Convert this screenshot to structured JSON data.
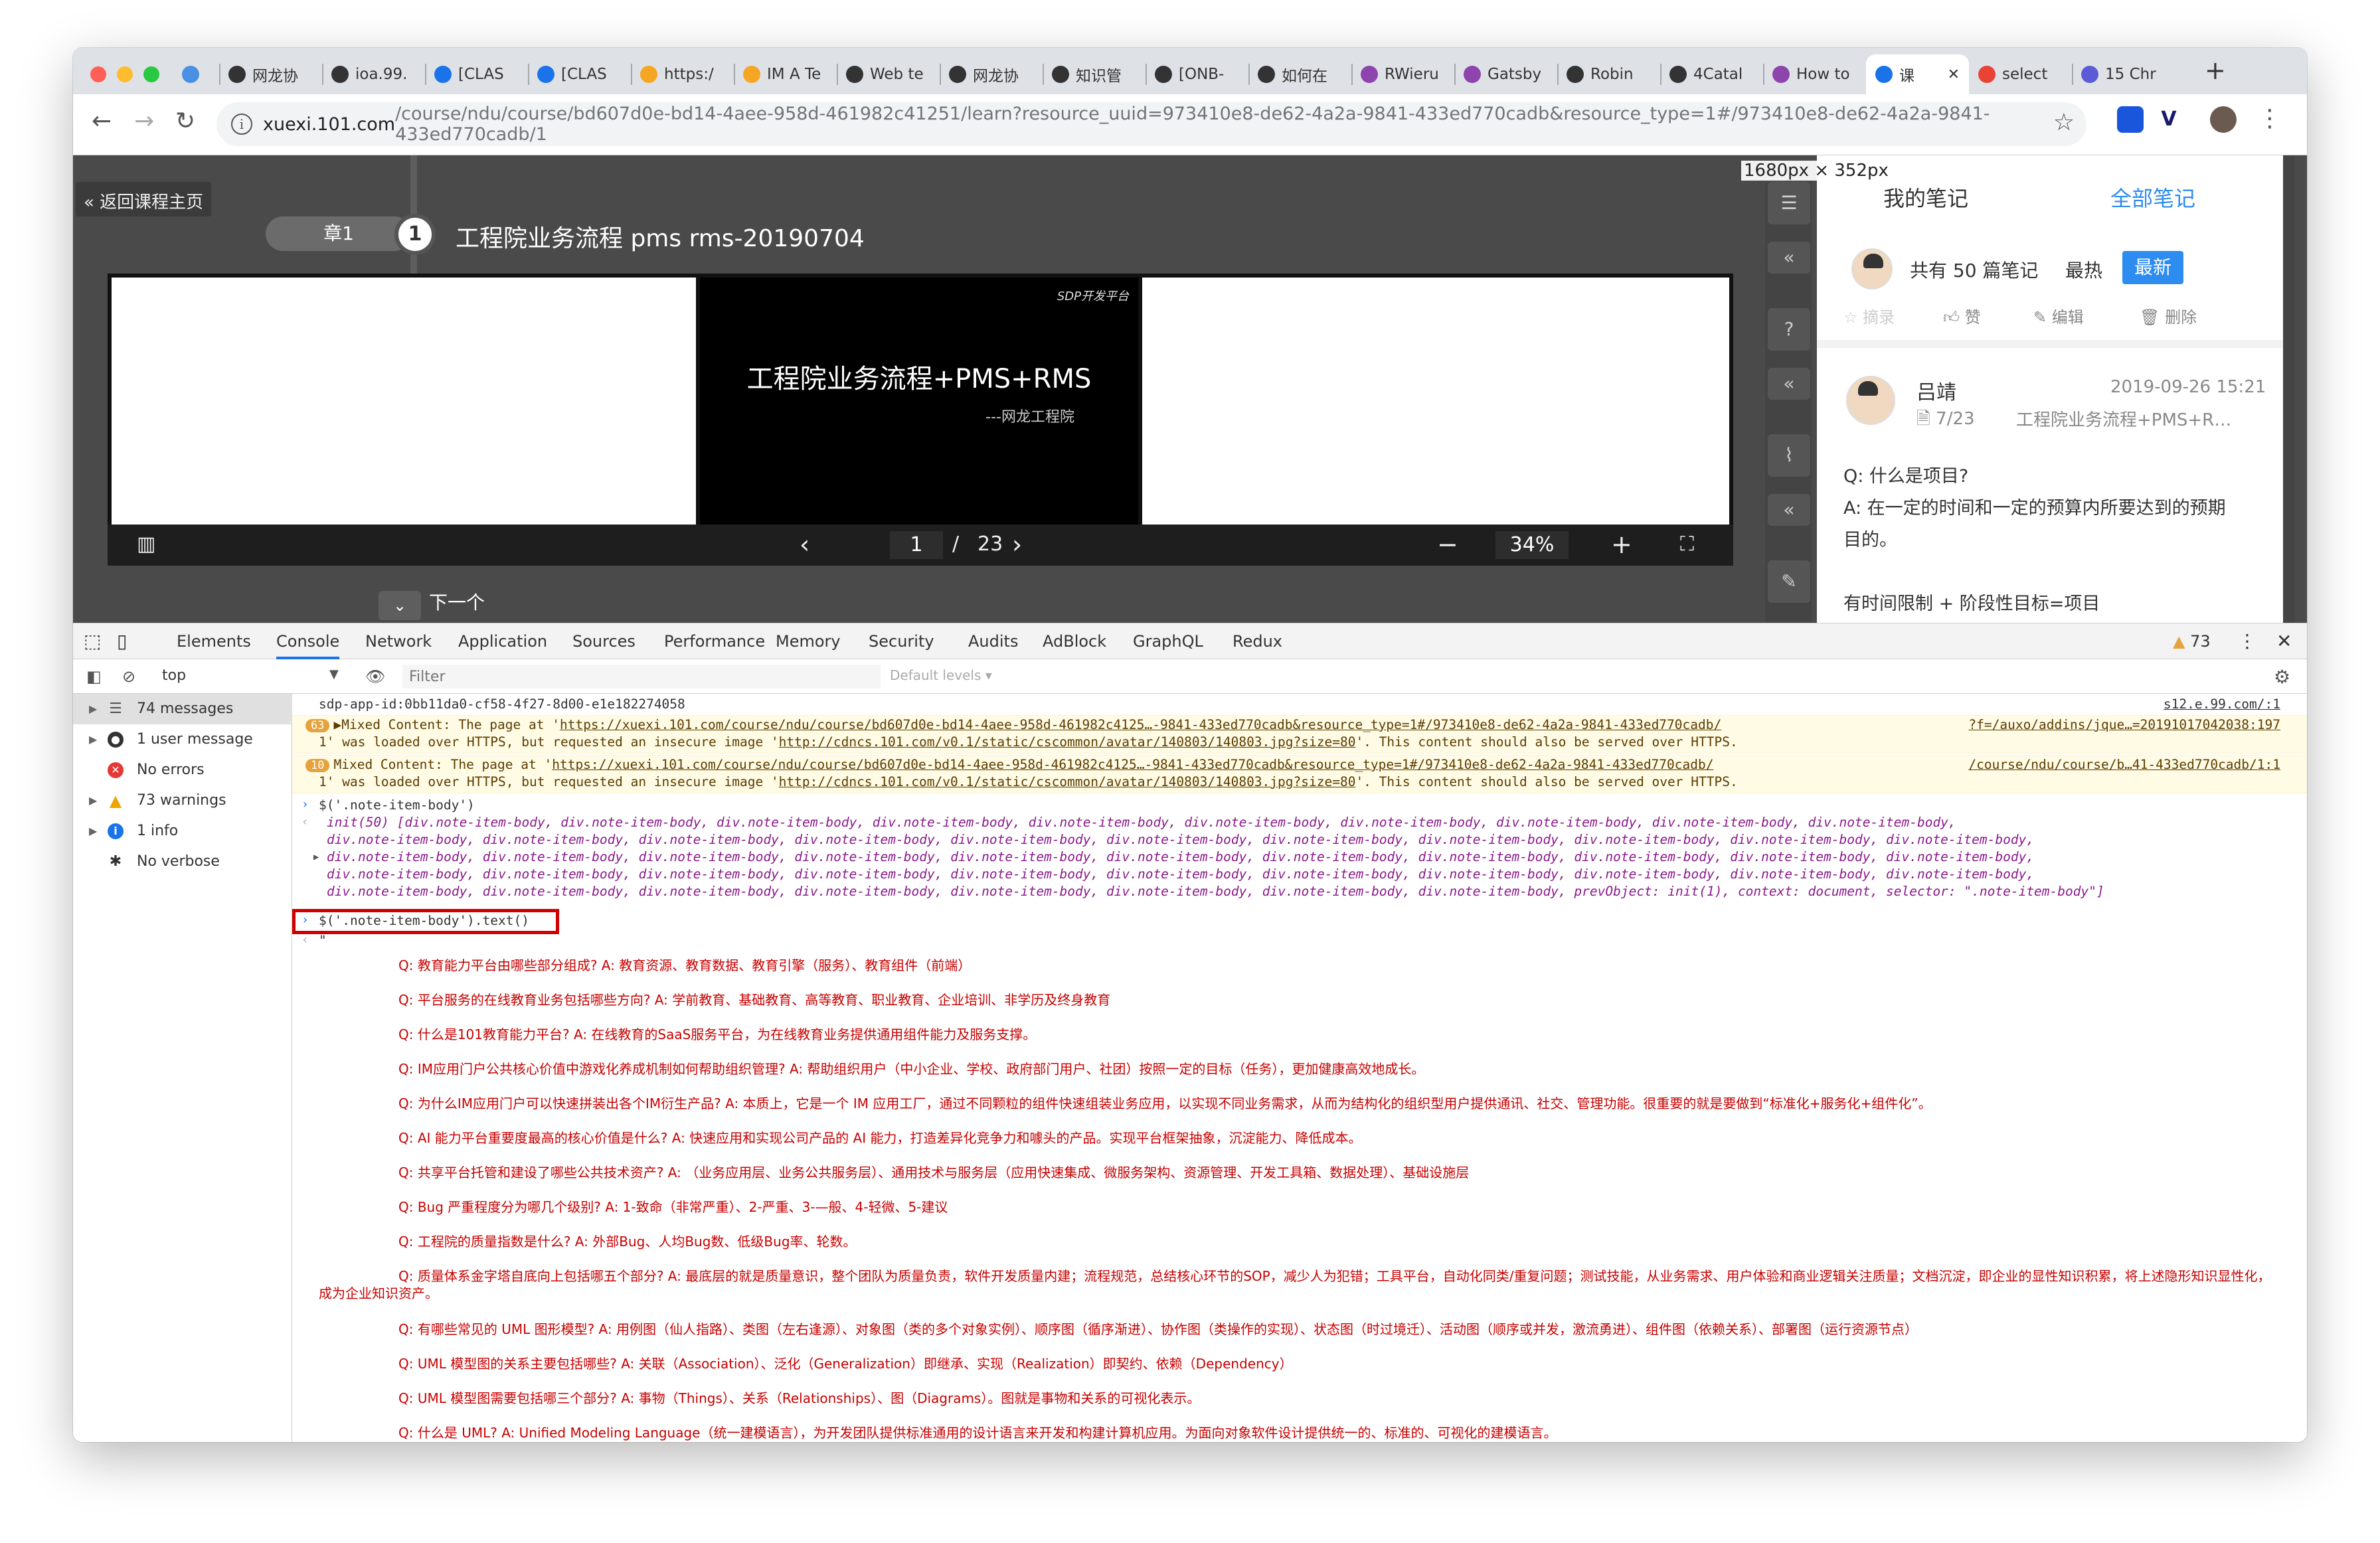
{
  "browser": {
    "tabs": [
      {
        "label": "",
        "favicon_color": "#4a90e2"
      },
      {
        "label": "网龙协",
        "favicon_color": "#333333"
      },
      {
        "label": "ioa.99.",
        "favicon_color": "#333333"
      },
      {
        "label": "[CLAS",
        "favicon_color": "#1a73e8"
      },
      {
        "label": "[CLAS",
        "favicon_color": "#1a73e8"
      },
      {
        "label": "https:/",
        "favicon_color": "#f5a623"
      },
      {
        "label": "IM A Te",
        "favicon_color": "#f5a623"
      },
      {
        "label": "Web te",
        "favicon_color": "#333333"
      },
      {
        "label": "网龙协",
        "favicon_color": "#333333"
      },
      {
        "label": "知识管",
        "favicon_color": "#333333"
      },
      {
        "label": "[ONB-",
        "favicon_color": "#333333"
      },
      {
        "label": "如何在",
        "favicon_color": "#333333"
      },
      {
        "label": "RWieru",
        "favicon_color": "#8e44ad"
      },
      {
        "label": "Gatsby",
        "favicon_color": "#8e44ad"
      },
      {
        "label": "Robin",
        "favicon_color": "#333333"
      },
      {
        "label": "4Catal",
        "favicon_color": "#333333"
      },
      {
        "label": "How to",
        "favicon_color": "#8e44ad"
      },
      {
        "label": "课",
        "favicon_color": "#1a73e8",
        "active": true
      },
      {
        "label": "select",
        "favicon_color": "#ea4335"
      },
      {
        "label": "15 Chr",
        "favicon_color": "#5b5bd6"
      }
    ],
    "new_tab": "+",
    "url_host": "xuexi.101.com",
    "url_path": "/course/ndu/course/bd607d0e-bd14-4aee-958d-461982c41251/learn?resource_uuid=973410e8-de62-4a2a-9841-433ed770cadb&resource_type=1#/973410e8-de62-4a2a-9841-433ed770cadb/1",
    "colors": {
      "tabbar": "#dee1e6",
      "red": "#ff5f57",
      "yellow": "#febc2e",
      "green": "#28c840"
    }
  },
  "course": {
    "back_label": "« 返回课程主页",
    "chapter_label": "章1",
    "chapter_num": "1",
    "lesson_title": "工程院业务流程 pms rms-20190704",
    "slide_logo": "SDP开发平台",
    "slide_title": "工程院业务流程+PMS+RMS",
    "slide_subtitle": "---网龙工程院",
    "page_current": "1",
    "page_sep": "/",
    "page_total": "23",
    "zoom": "34%",
    "next_label": "下一个",
    "dimension_badge": "1680px × 352px"
  },
  "notes": {
    "tab_mine": "我的笔记",
    "tab_all": "全部笔记",
    "count_label": "共有 50 篇笔记",
    "sort_hot": "最热",
    "sort_new": "最新",
    "act_excerpt": "摘录",
    "act_like": "赞",
    "act_edit": "编辑",
    "act_delete": "删除",
    "author": "吕靖",
    "date": "2019-09-26 15:21",
    "page_ref": "7/23",
    "source": "工程院业务流程+PMS+R…",
    "body": [
      "Q: 什么是项目?",
      "A: 在一定的时间和一定的预算内所要达到的预期",
      "目的。",
      "",
      "有时间限制 + 阶段性目标=项目"
    ]
  },
  "devtools": {
    "tabs": [
      "Elements",
      "Console",
      "Network",
      "Application",
      "Sources",
      "Performance",
      "Memory",
      "Security",
      "Audits",
      "AdBlock",
      "GraphQL",
      "Redux"
    ],
    "warn_count": "73",
    "context": "top",
    "filter_placeholder": "Filter",
    "levels": "Default levels ▾",
    "sidebar": [
      {
        "label": "74 messages",
        "icon": "list-icon"
      },
      {
        "label": "1 user message",
        "icon": "user-icon"
      },
      {
        "label": "No errors",
        "icon": "error-icon"
      },
      {
        "label": "73 warnings",
        "icon": "warning-icon"
      },
      {
        "label": "1 info",
        "icon": "info-icon"
      },
      {
        "label": "No verbose",
        "icon": "bug-icon"
      }
    ],
    "console": {
      "line1": "sdp-app-id:0bb11da0-cf58-4f27-8d00-e1e182274058",
      "line1_src": "s12.e.99.com/:1",
      "warn1_count": "63",
      "warn1_a": "Mixed Content: The page at '",
      "warn1_url": "https://xuexi.101.com/course/ndu/course/bd607d0e-bd14-4aee-958d-461982c4125…-9841-433ed770cadb&resource_type=1#/973410e8-de62-4a2a-9841-433ed770cadb/",
      "warn1_src": "?f=/auxo/addins/jque…=20191017042038:197",
      "warn1_b": "1' was loaded over HTTPS, but requested an insecure image '",
      "warn1_img": "http://cdncs.101.com/v0.1/static/cscommon/avatar/140803/140803.jpg?size=80",
      "warn1_c": "'. This content should also be served over HTTPS.",
      "warn2_count": "10",
      "warn2_a": "Mixed Content: The page at '",
      "warn2_url": "https://xuexi.101.com/course/ndu/course/bd607d0e-bd14-4aee-958d-461982c4125…-9841-433ed770cadb&resource_type=1#/973410e8-de62-4a2a-9841-433ed770cadb/",
      "warn2_src": "/course/ndu/course/b…41-433ed770cadb/1:1",
      "warn2_b": "1' was loaded over HTTPS, but requested an insecure image '",
      "warn2_img": "http://cdncs.101.com/v0.1/static/cscommon/avatar/140803/140803.jpg?size=80",
      "warn2_c": "'. This content should also be served over HTTPS.",
      "cmd1": "$('.note-item-body')",
      "res1_l1": "init(50) [div.note-item-body, div.note-item-body, div.note-item-body, div.note-item-body, div.note-item-body, div.note-item-body, div.note-item-body, div.note-item-body, div.note-item-body, div.note-item-body,",
      "res1_l2": "div.note-item-body, div.note-item-body, div.note-item-body, div.note-item-body, div.note-item-body, div.note-item-body, div.note-item-body, div.note-item-body, div.note-item-body, div.note-item-body, div.note-item-body,",
      "res1_l3": "div.note-item-body, div.note-item-body, div.note-item-body, div.note-item-body, div.note-item-body, div.note-item-body, div.note-item-body, div.note-item-body, div.note-item-body, div.note-item-body, div.note-item-body,",
      "res1_l4": "div.note-item-body, div.note-item-body, div.note-item-body, div.note-item-body, div.note-item-body, div.note-item-body, div.note-item-body, div.note-item-body, div.note-item-body, div.note-item-body, div.note-item-body,",
      "res1_l5": "div.note-item-body, div.note-item-body, div.note-item-body, div.note-item-body, div.note-item-body, div.note-item-body, div.note-item-body, div.note-item-body, prevObject: init(1), context: document, selector: \".note-item-body\"]",
      "cmd2": "$('.note-item-body').text()",
      "quote": "\"",
      "qa": [
        "Q: 教育能力平台由哪些部分组成? A: 教育资源、教育数据、教育引擎（服务）、教育组件（前端）",
        "Q: 平台服务的在线教育业务包括哪些方向? A: 学前教育、基础教育、高等教育、职业教育、企业培训、非学历及终身教育",
        "Q: 什么是101教育能力平台? A: 在线教育的SaaS服务平台，为在线教育业务提供通用组件能力及服务支撑。",
        "Q: IM应用门户公共核心价值中游戏化养成机制如何帮助组织管理? A: 帮助组织用户（中小企业、学校、政府部门用户、社团）按照一定的目标（任务），更加健康高效地成长。",
        "Q: 为什么IM应用门户可以快速拼装出各个IM衍生产品? A: 本质上，它是一个 IM 应用工厂，通过不同颗粒的组件快速组装业务应用，以实现不同业务需求，从而为结构化的组织型用户提供通讯、社交、管理功能。很重要的就是要做到“标准化+服务化+组件化”。",
        "Q: AI 能力平台重要度最高的核心价值是什么? A: 快速应用和实现公司产品的 AI 能力，打造差异化竞争力和噱头的产品。实现平台框架抽象，沉淀能力、降低成本。",
        "Q: 共享平台托管和建设了哪些公共技术资产? A: （业务应用层、业务公共服务层）、通用技术与服务层（应用快速集成、微服务架构、资源管理、开发工具箱、数据处理）、基础设施层",
        "Q: Bug 严重程度分为哪几个级别? A: 1-致命（非常严重）、2-严重、3-—般、4-轻微、5-建议",
        "Q: 工程院的质量指数是什么? A: 外部Bug、人均Bug数、低级Bug率、轮数。",
        "Q: 质量体系金字塔自底向上包括哪五个部分? A: 最底层的就是质量意识，整个团队为质量负责，软件开发质量内建；流程规范，总结核心环节的SOP，减少人为犯错；工具平台，自动化同类/重复问题；测试技能，从业务需求、用户体验和商业逻辑关注质量；文档沉淀，即企业的显性知识积累，将上述隐形知识显性化，成为企业知识资产。",
        "Q: 有哪些常见的 UML 图形模型? A: 用例图（仙人指路）、类图（左右逢源）、对象图（类的多个对象实例）、顺序图（循序渐进）、协作图（类操作的实现）、状态图（时过境迁）、活动图（顺序或并发，激流勇进）、组件图（依赖关系）、部署图（运行资源节点）",
        "Q: UML 模型图的关系主要包括哪些? A: 关联（Association）、泛化（Generalization）即继承、实现（Realization）即契约、依赖（Dependency）",
        "Q: UML 模型图需要包括哪三个部分? A: 事物（Things）、关系（Relationships）、图（Diagrams）。图就是事物和关系的可视化表示。",
        "Q: 什么是 UML? A: Unified Modeling Language（统一建模语言），为开发团队提供标准通用的设计语言来开发和构建计算机应用。为面向对象软件设计提供统一的、标准的、可视化的建模语言。"
      ]
    }
  }
}
